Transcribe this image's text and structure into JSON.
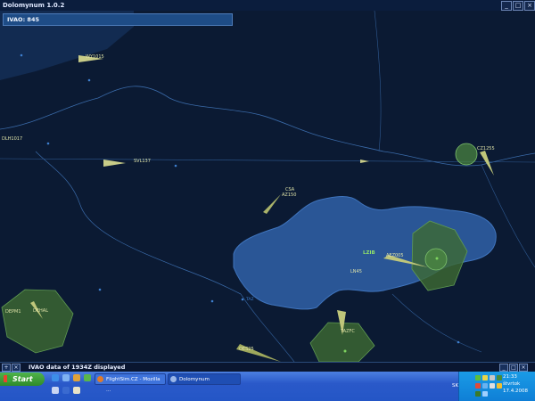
{
  "app": {
    "title": "Dolomynum 1.0.2"
  },
  "window_controls": [
    "_",
    "□",
    "×"
  ],
  "ivao_bar": {
    "text": "IVAO: 845"
  },
  "status": {
    "message": "IVAO data of 1934Z displayed",
    "buttons": [
      "+",
      "×"
    ]
  },
  "map": {
    "land_color": "#2a5696",
    "sea_color": "#0b1a33",
    "callsigns": [
      "WY1015",
      "DLH1017",
      "SVL137",
      "CSA",
      "AZ150",
      "LZIB",
      "AEZ005",
      "LN45",
      "DEHAL",
      "DEPM1",
      "TAZFC",
      "OES25",
      "CZ1255"
    ],
    "city_label_a": "TAZ"
  },
  "taskbar": {
    "start_label": "Start",
    "tasks": [
      "FlightSim.CZ - Mozilla ...",
      "Dolomynum"
    ],
    "lang": "SK",
    "time": "21:33",
    "day": "štvrtok",
    "date": "17.4.2008"
  }
}
